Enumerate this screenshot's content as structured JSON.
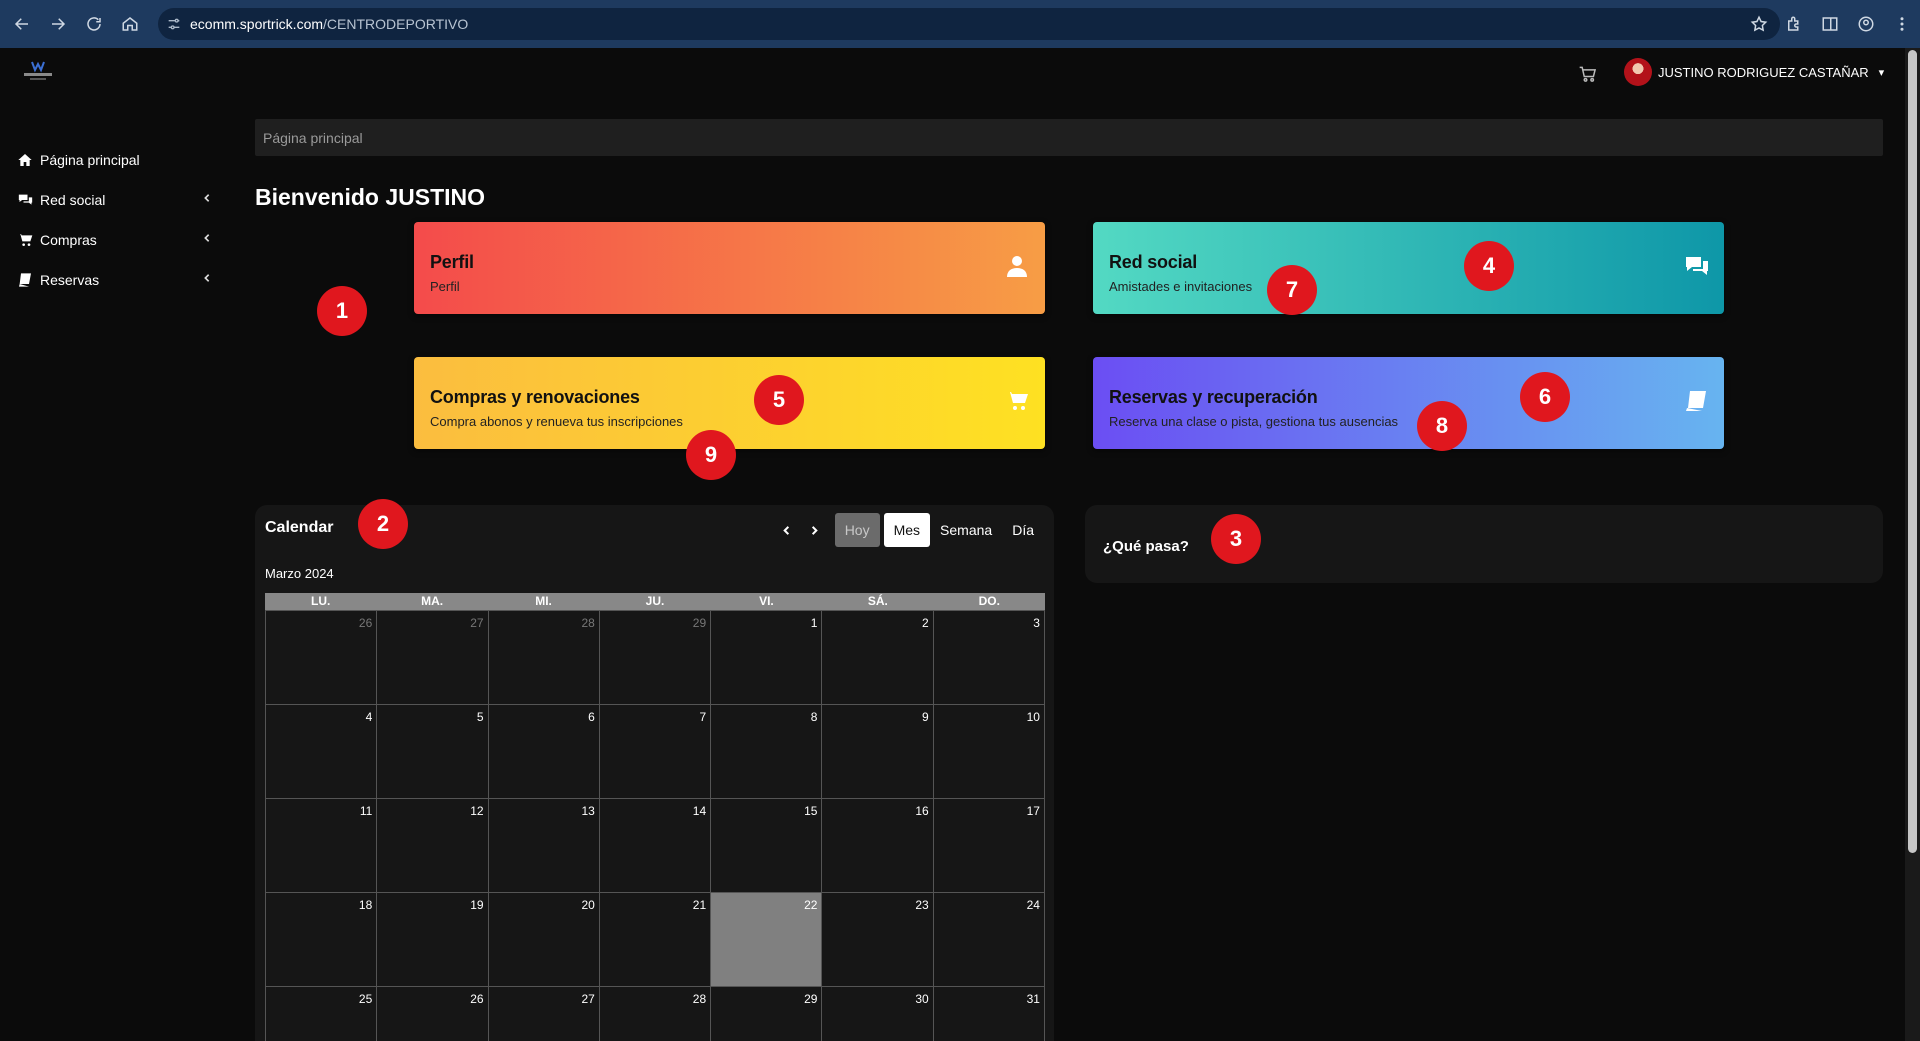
{
  "browser": {
    "url_host": "ecomm.sportrick.com",
    "url_path": "/CENTRODEPORTIVO"
  },
  "header": {
    "user_name": "JUSTINO RODRIGUEZ CASTAÑAR"
  },
  "sidebar": {
    "items": [
      {
        "label": "Página principal",
        "icon": "home-icon"
      },
      {
        "label": "Red social",
        "icon": "comments-icon"
      },
      {
        "label": "Compras",
        "icon": "cart-icon"
      },
      {
        "label": "Reservas",
        "icon": "book-icon"
      }
    ]
  },
  "breadcrumb": "Página principal",
  "welcome": "Bienvenido JUSTINO",
  "cards": {
    "perfil": {
      "title": "Perfil",
      "subtitle": "Perfil",
      "icon": "user-icon"
    },
    "red_social": {
      "title": "Red social",
      "subtitle": "Amistades e invitaciones",
      "icon": "comments-icon"
    },
    "compras": {
      "title": "Compras y renovaciones",
      "subtitle": "Compra abonos y renueva tus inscripciones",
      "icon": "cart-icon"
    },
    "reservas": {
      "title": "Reservas y recuperación",
      "subtitle": "Reserva una clase o pista, gestiona tus ausencias",
      "icon": "book-icon"
    }
  },
  "markers": [
    "1",
    "2",
    "3",
    "4",
    "5",
    "6",
    "7",
    "8",
    "9"
  ],
  "calendar": {
    "title": "Calendar",
    "prev": "‹",
    "next": "›",
    "today_label": "Hoy",
    "views": [
      "Mes",
      "Semana",
      "Día"
    ],
    "active_view": "Mes",
    "month_label": "Marzo 2024",
    "weekdays": [
      "LU.",
      "MA.",
      "MI.",
      "JU.",
      "VI.",
      "SÁ.",
      "DO."
    ],
    "weeks": [
      [
        "26",
        "27",
        "28",
        "29",
        "1",
        "2",
        "3"
      ],
      [
        "4",
        "5",
        "6",
        "7",
        "8",
        "9",
        "10"
      ],
      [
        "11",
        "12",
        "13",
        "14",
        "15",
        "16",
        "17"
      ],
      [
        "18",
        "19",
        "20",
        "21",
        "22",
        "23",
        "24"
      ],
      [
        "25",
        "26",
        "27",
        "28",
        "29",
        "30",
        "31"
      ]
    ],
    "today": "22"
  },
  "news": {
    "title": "¿Qué pasa?"
  }
}
